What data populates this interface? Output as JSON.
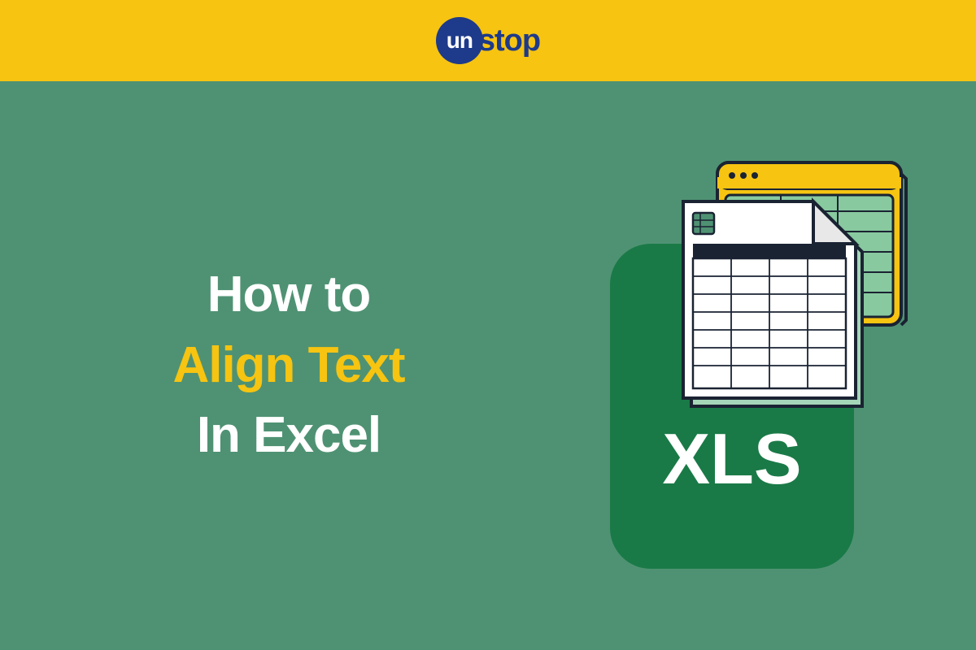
{
  "logo": {
    "prefix": "un",
    "suffix": "stop"
  },
  "title": {
    "line1": "How to",
    "line2": "Align Text",
    "line3": "In Excel"
  },
  "file_badge": "XLS",
  "colors": {
    "banner": "#f6c411",
    "background": "#4f9273",
    "accent": "#1e3a8a",
    "xls_green": "#1a7a47"
  }
}
